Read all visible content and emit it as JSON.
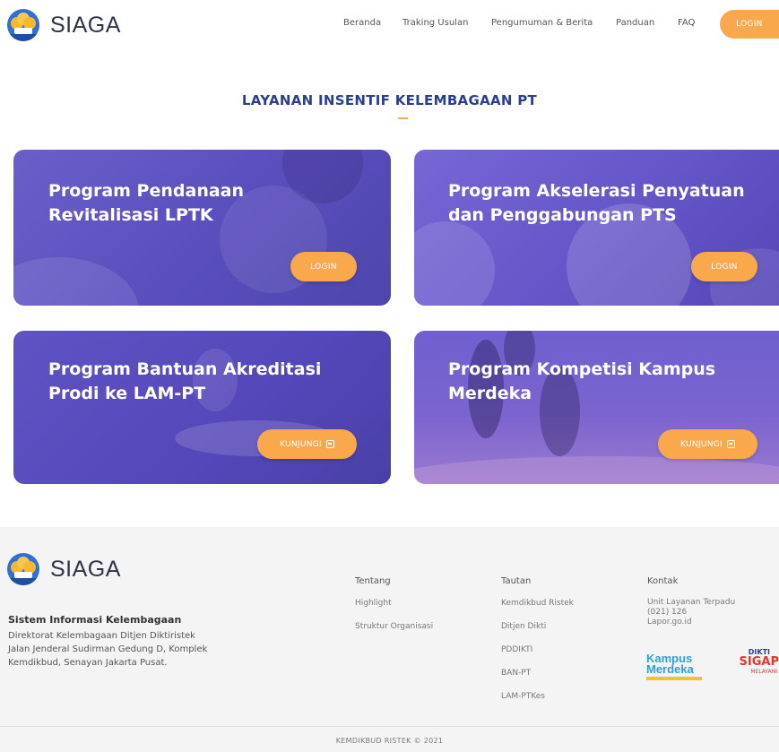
{
  "brand": {
    "name": "SIAGA"
  },
  "nav": {
    "items": [
      "Beranda",
      "Traking Usulan",
      "Pengumuman & Berita",
      "Panduan",
      "FAQ"
    ],
    "login_label": "LOGIN"
  },
  "section": {
    "title": "LAYANAN INSENTIF KELEMBAGAAN PT"
  },
  "cards": [
    {
      "title_line1": "Program Pendanaan",
      "title_line2": "Revitalisasi LPTK",
      "button": "LOGIN"
    },
    {
      "title_line1": "Program Akselerasi Penyatuan",
      "title_line2": "dan Penggabungan PTS",
      "button": "LOGIN"
    },
    {
      "title_line1": "Program Bantuan Akreditasi",
      "title_line2": "Prodi ke LAM-PT",
      "button": "KUNJUNGI"
    },
    {
      "title_line1": "Program Kompetisi Kampus",
      "title_line2": "Merdeka",
      "button": "KUNJUNGI"
    }
  ],
  "footer": {
    "org_name": "Sistem Informasi Kelembagaan",
    "address": "Direktorat Kelembagaan Ditjen Diktiristek Jalan Jenderal Sudirman Gedung D, Komplek Kemdikbud, Senayan Jakarta Pusat.",
    "tentang": {
      "title": "Tentang",
      "links": [
        "Highlight",
        "Struktur Organisasi"
      ]
    },
    "tautan": {
      "title": "Tautan",
      "links": [
        "Kemdikbud Ristek",
        "Ditjen Dikti",
        "PDDIKTI",
        "BAN-PT",
        "LAM-PTKes"
      ]
    },
    "kontak": {
      "title": "Kontak",
      "lines": [
        "Unit Layanan Terpadu",
        "(021) 126",
        "Lapor.go.id"
      ]
    },
    "logos": {
      "kampus_merdeka": [
        "Kampus",
        "Merdeka"
      ],
      "sigap": [
        "DIKTI",
        "SIGAP",
        "MELAYANI"
      ]
    },
    "copyright": "KEMDIKBUD RISTEK © 2021"
  }
}
